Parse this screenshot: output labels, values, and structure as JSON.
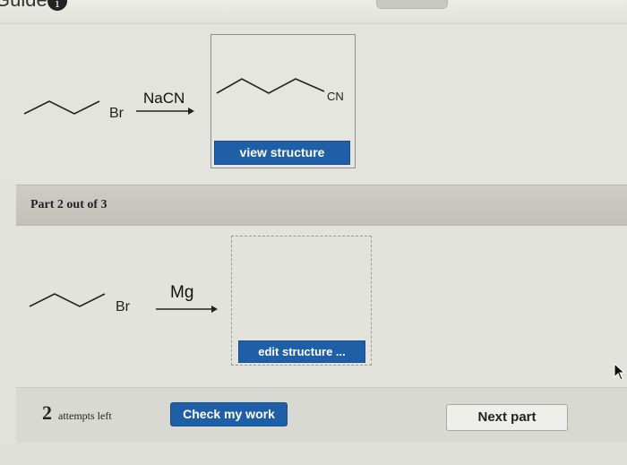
{
  "header": {
    "guide_text": "Guide",
    "info_glyph": "i"
  },
  "part1": {
    "reactant_label": "Br",
    "reagent": "NaCN",
    "product_group": "CN",
    "view_button": "view structure"
  },
  "part2": {
    "header": "Part 2 out of 3",
    "reactant_label": "Br",
    "reagent": "Mg",
    "edit_button": "edit structure ..."
  },
  "footer": {
    "attempts_count": "2",
    "attempts_text": "attempts left",
    "check_button": "Check my work",
    "next_button": "Next part"
  },
  "colors": {
    "primary_button": "#1f5fa8",
    "background": "#e2e2dc"
  },
  "icons": [
    "info-icon",
    "mouse-cursor-icon",
    "reaction-arrow-icon"
  ]
}
